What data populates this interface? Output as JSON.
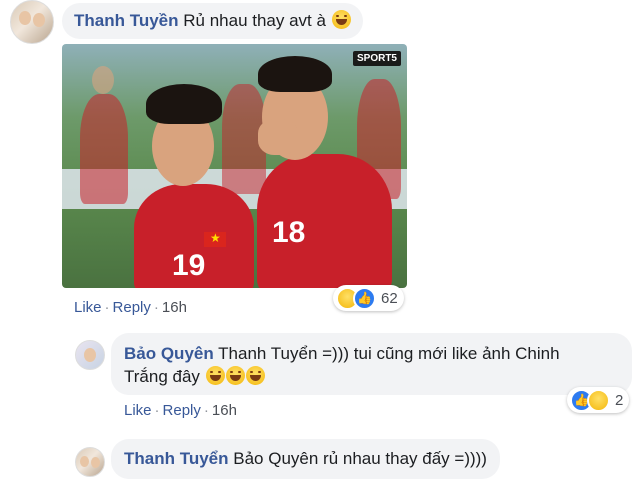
{
  "comments": [
    {
      "author": "Thanh Tuyền",
      "text": "Rủ nhau thay avt à",
      "emoji_count": 1,
      "actions": {
        "like": "Like",
        "reply": "Reply",
        "time": "16h"
      },
      "reactions": {
        "icons": [
          "haha-reaction-icon",
          "like-reaction-icon"
        ],
        "count": "62"
      },
      "photo": {
        "logo_text": "SPORT5",
        "jersey_numbers": [
          "19",
          "18"
        ]
      }
    },
    {
      "author": "Bảo Quyên",
      "text_line1": "Thanh Tuyển =))) tui cũng mới like ảnh Chinh",
      "text_line2": "Trắng đây",
      "emoji_count": 3,
      "actions": {
        "like": "Like",
        "reply": "Reply",
        "time": "16h"
      },
      "reactions": {
        "icons": [
          "like-reaction-icon",
          "haha-reaction-icon"
        ],
        "count": "2"
      }
    },
    {
      "author": "Thanh Tuyển",
      "text": "Bảo Quyên rủ nhau thay đấy =))))"
    }
  ],
  "colors": {
    "author": "#385898",
    "bubble": "#f2f3f5",
    "like_blue": "#2d7bf0"
  }
}
